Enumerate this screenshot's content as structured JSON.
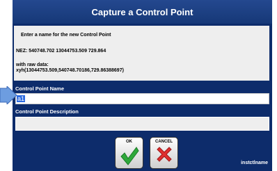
{
  "dialog": {
    "title": "Capture a Control Point",
    "prompt": "Enter a name for the new Control Point",
    "nez_line": "NEZ:  540748.702  13044753.509  729.864",
    "raw_label": "with raw data:",
    "raw_value": "xyh(13044753.509,540748.70186,729.86388697)"
  },
  "name_field": {
    "label": "Control Point Name",
    "value": "a1"
  },
  "description_field": {
    "label": "Control Point Description",
    "value": ""
  },
  "buttons": {
    "ok_label": "OK",
    "cancel_label": "CANCEL"
  },
  "footer": {
    "instance_name": "instctlname"
  },
  "colors": {
    "dialog_bg": "#0d2c6b",
    "title_bg": "#1c3f85",
    "selection": "#2d6be0",
    "ok_green": "#2ea83a",
    "cancel_red": "#e03030",
    "pointer": "#6d9de0"
  },
  "icons": {
    "ok": "checkmark-icon",
    "cancel": "x-cross-icon",
    "pointer": "arrow-pointer-icon"
  }
}
